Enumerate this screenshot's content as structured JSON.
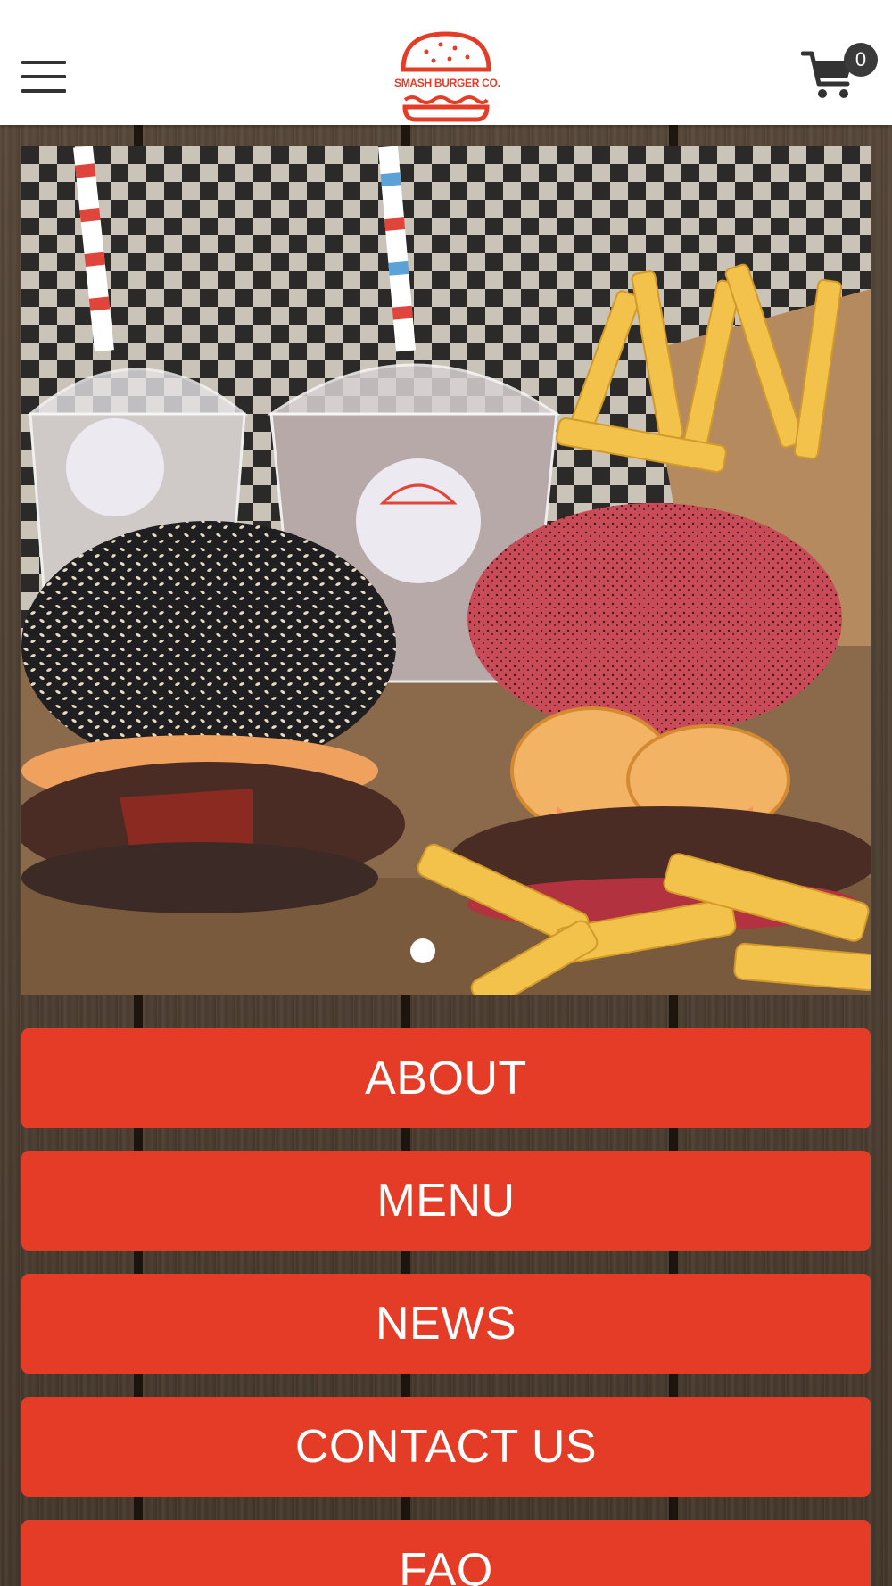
{
  "header": {
    "menu_icon": "hamburger-menu-icon",
    "logo": {
      "text": "SMASH BURGER CO.",
      "icon": "burger-logo-icon",
      "color": "#e43c27"
    },
    "cart": {
      "icon": "shopping-cart-icon",
      "count": "0"
    }
  },
  "hero": {
    "image_description_icon": "burger-photo",
    "carousel_dots": 1,
    "active_dot": 1
  },
  "nav_buttons": [
    {
      "label": "ABOUT"
    },
    {
      "label": "MENU"
    },
    {
      "label": "NEWS"
    },
    {
      "label": "CONTACT US"
    },
    {
      "label": "FAQ"
    }
  ],
  "colors": {
    "accent": "#e43c27",
    "header_bg": "#ffffff",
    "icon_dark": "#333333"
  }
}
